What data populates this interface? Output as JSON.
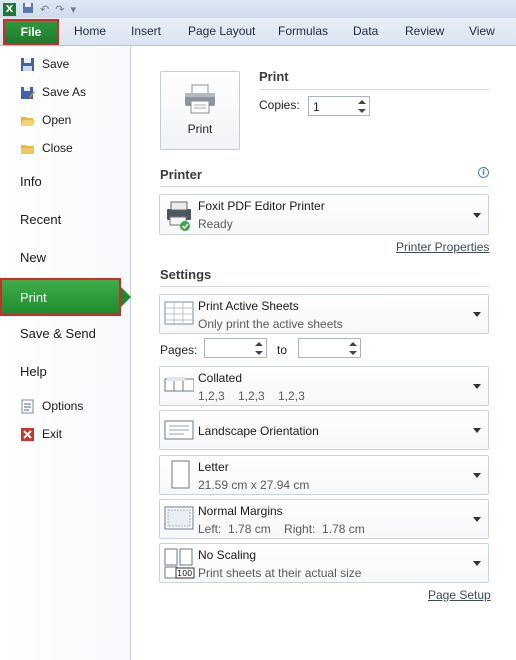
{
  "quick_access": {
    "app_icon": "excel-icon",
    "icons": [
      "save-icon",
      "undo-icon",
      "redo-icon",
      "customize-icon"
    ]
  },
  "ribbon": {
    "file_label": "File",
    "tabs": [
      "Home",
      "Insert",
      "Page Layout",
      "Formulas",
      "Data",
      "Review",
      "View"
    ]
  },
  "backstage_nav": {
    "save": "Save",
    "save_as": "Save As",
    "open": "Open",
    "close": "Close",
    "info": "Info",
    "recent": "Recent",
    "new": "New",
    "print": "Print",
    "save_send": "Save & Send",
    "help": "Help",
    "options": "Options",
    "exit": "Exit"
  },
  "print": {
    "heading": "Print",
    "button_label": "Print",
    "copies_label": "Copies:",
    "copies_value": "1"
  },
  "printer": {
    "heading": "Printer",
    "name": "Foxit PDF Editor Printer",
    "status": "Ready",
    "properties_link": "Printer Properties"
  },
  "settings": {
    "heading": "Settings",
    "scope_title": "Print Active Sheets",
    "scope_desc": "Only print the active sheets",
    "pages_label": "Pages:",
    "to_label": "to",
    "collate_title": "Collated",
    "collate_desc": "1,2,3    1,2,3    1,2,3",
    "orientation_title": "Landscape Orientation",
    "paper_title": "Letter",
    "paper_desc": "21.59 cm x 27.94 cm",
    "margins_title": "Normal Margins",
    "margins_desc": "Left:  1.78 cm    Right:  1.78 cm",
    "scaling_title": "No Scaling",
    "scaling_desc": "Print sheets at their actual size",
    "scaling_badge": "100",
    "page_setup_link": "Page Setup"
  },
  "colors": {
    "file_green": "#1d7a2c",
    "highlight_red": "#d9262b",
    "ribbon_blue": "#dbe4f1"
  }
}
